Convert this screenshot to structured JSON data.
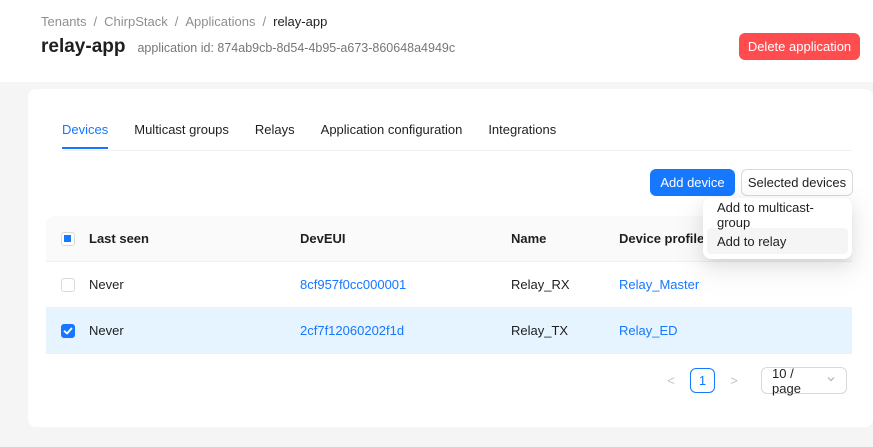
{
  "breadcrumb": {
    "items": [
      "Tenants",
      "ChirpStack",
      "Applications",
      "relay-app"
    ],
    "separator": "/"
  },
  "header": {
    "title": "relay-app",
    "subtitle": "application id: 874ab9cb-8d54-4b95-a673-860648a4949c",
    "delete_label": "Delete application"
  },
  "tabs": [
    {
      "label": "Devices",
      "active": true
    },
    {
      "label": "Multicast groups",
      "active": false
    },
    {
      "label": "Relays",
      "active": false
    },
    {
      "label": "Application configuration",
      "active": false
    },
    {
      "label": "Integrations",
      "active": false
    }
  ],
  "toolbar": {
    "add_device_label": "Add device",
    "selected_devices_label": "Selected devices"
  },
  "dropdown": {
    "items": [
      {
        "label": "Add to multicast-group"
      },
      {
        "label": "Add to relay"
      }
    ]
  },
  "table": {
    "columns": [
      "Last seen",
      "DevEUI",
      "Name",
      "Device profile"
    ],
    "rows": [
      {
        "selected": false,
        "last_seen": "Never",
        "deveui": "8cf957f0cc000001",
        "name": "Relay_RX",
        "device_profile": "Relay_Master"
      },
      {
        "selected": true,
        "last_seen": "Never",
        "deveui": "2cf7f12060202f1d",
        "name": "Relay_TX",
        "device_profile": "Relay_ED"
      }
    ]
  },
  "pagination": {
    "prev": "<",
    "current_page": "1",
    "next": ">",
    "page_size": "10 / page"
  },
  "colors": {
    "primary": "#1677ff",
    "danger": "#ff4d4f",
    "selected_row": "#e6f4ff"
  }
}
